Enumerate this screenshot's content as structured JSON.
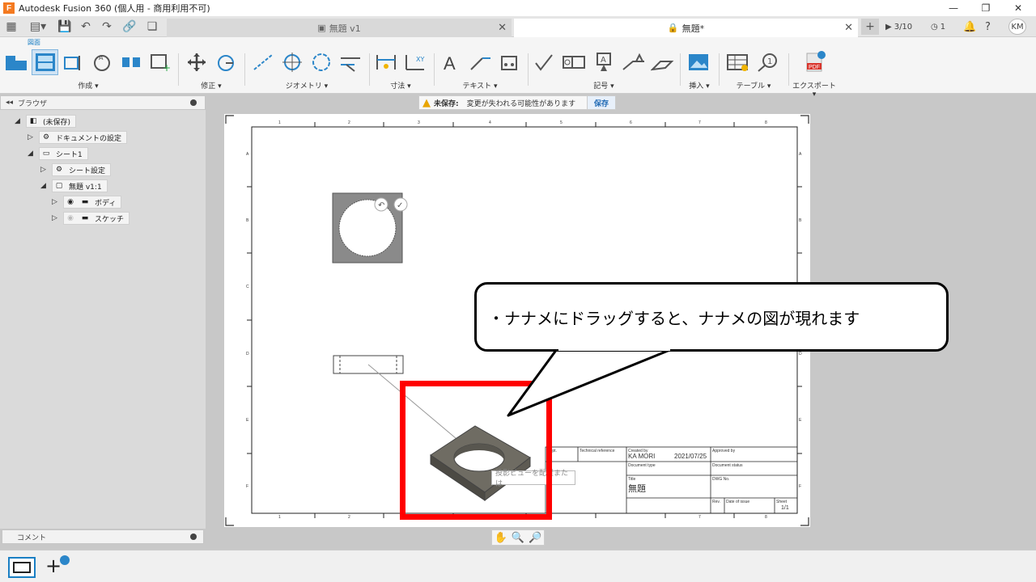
{
  "window": {
    "title": "Autodesk Fusion 360 (個人用 - 商用利用不可)",
    "app_icon_letter": "F"
  },
  "tabs": [
    {
      "label": "無題 v1",
      "active": false
    },
    {
      "label": "無題*",
      "active": true
    }
  ],
  "header_right": {
    "jobs": "3/10",
    "clock": "1",
    "user": "KM"
  },
  "toolbar": {
    "mode": "図面",
    "groups": [
      {
        "label": "作成 ▾"
      },
      {
        "label": "修正 ▾"
      },
      {
        "label": "ジオメトリ ▾"
      },
      {
        "label": "寸法 ▾"
      },
      {
        "label": "テキスト ▾"
      },
      {
        "label": "記号 ▾"
      },
      {
        "label": "挿入 ▾"
      },
      {
        "label": "テーブル ▾"
      },
      {
        "label": "エクスポート ▾"
      }
    ]
  },
  "browser": {
    "title": "ブラウザ",
    "items": [
      {
        "label": "(未保存)"
      },
      {
        "label": "ドキュメントの設定"
      },
      {
        "label": "シート1"
      },
      {
        "label": "シート設定"
      },
      {
        "label": "無題 v1:1"
      },
      {
        "label": "ボディ"
      },
      {
        "label": "スケッチ"
      }
    ]
  },
  "comments": {
    "title": "コメント"
  },
  "warning": {
    "prefix": "未保存:",
    "message": "変更が失われる可能性があります",
    "save": "保存"
  },
  "sheet": {
    "columns_top": [
      "1",
      "2",
      "3",
      "4",
      "5",
      "6",
      "7",
      "8"
    ],
    "rows_left": [
      "A",
      "B",
      "C",
      "D",
      "E",
      "F"
    ],
    "title_block": {
      "dept": "Dept.",
      "tech_ref": "Technical reference",
      "created_by_label": "Created by",
      "created_by": "KA MORI",
      "date": "2021/07/25",
      "approved_by_label": "Approved by",
      "doc_type_label": "Document type",
      "doc_status_label": "Document status",
      "title_label": "Title",
      "title": "無題",
      "dwg_label": "DWG No.",
      "rev_label": "Rev.",
      "date_issue_label": "Date of issue",
      "sheet_label": "Sheet",
      "sheet": "1/1"
    },
    "tooltip": "投影ビューを配置または"
  },
  "callout": {
    "text": "・ナナメにドラッグすると、ナナメの図が現れます"
  },
  "colors": {
    "accent": "#1a7fc4",
    "highlight": "#ff0000",
    "body_fill": "#8a8a8a"
  }
}
